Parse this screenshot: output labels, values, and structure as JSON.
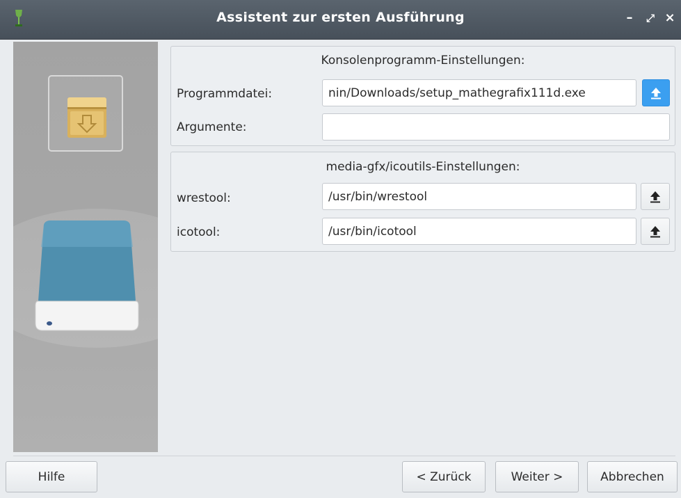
{
  "window": {
    "title": "Assistent zur ersten Ausführung",
    "minimize": "–",
    "maximize": "⤢",
    "close": "×"
  },
  "console_group": {
    "title": "Konsolenprogramm-Einstellungen:",
    "program_label": "Programmdatei:",
    "program_value": "nin/Downloads/setup_mathegrafix111d.exe",
    "args_label": "Argumente:",
    "args_value": ""
  },
  "icoutils_group": {
    "title": "media-gfx/icoutils-Einstellungen:",
    "wrestool_label": "wrestool:",
    "wrestool_value": "/usr/bin/wrestool",
    "icotool_label": "icotool:",
    "icotool_value": "/usr/bin/icotool"
  },
  "footer": {
    "help": "Hilfe",
    "back": "< Zurück",
    "next": "Weiter >",
    "cancel": "Abbrechen"
  },
  "icons": {
    "app": "wine-glass-icon",
    "package": "package-icon",
    "drive": "drive-icon",
    "browse": "upload-arrow-icon"
  },
  "colors": {
    "titlebar": "#4f5861",
    "accent": "#3b9ff0",
    "sidebar": "#a6a6a6"
  }
}
